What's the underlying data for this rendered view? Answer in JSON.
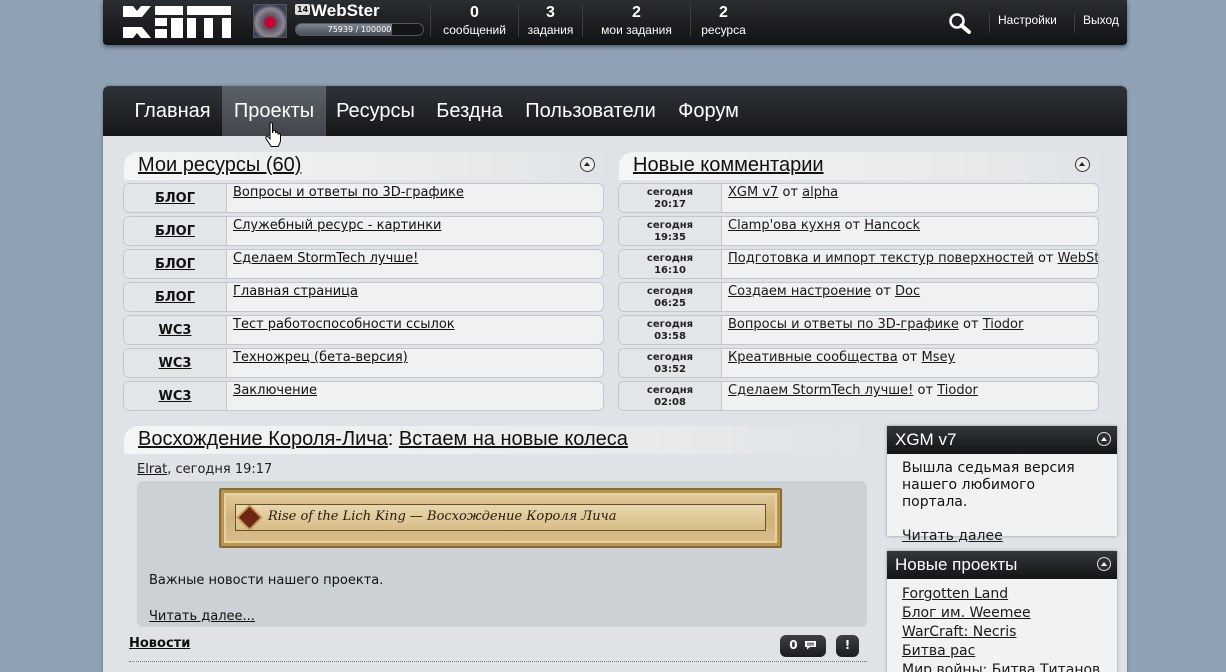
{
  "topbar": {
    "user": {
      "level": "14",
      "name": "WebSter",
      "xp": "75939 / 100000",
      "xp_fraction": 0.759
    },
    "stats": [
      {
        "value": "0",
        "label": "сообщений"
      },
      {
        "value": "3",
        "label": "задания"
      },
      {
        "value": "2",
        "label": "мои задания"
      },
      {
        "value": "2",
        "label": "ресурса"
      }
    ],
    "links": {
      "settings": "Настройки",
      "logout": "Выход"
    }
  },
  "nav": {
    "items": [
      "Главная",
      "Проекты",
      "Ресурсы",
      "Бездна",
      "Пользователи",
      "Форум"
    ],
    "active": "Проекты"
  },
  "my_resources": {
    "title": "Мои ресурсы (60)",
    "rows": [
      {
        "tag": "БЛОГ",
        "text": "Вопросы и ответы по 3D-графике"
      },
      {
        "tag": "БЛОГ",
        "text": "Служебный ресурс - картинки"
      },
      {
        "tag": "БЛОГ",
        "text": "Сделаем StormTech лучше!"
      },
      {
        "tag": "БЛОГ",
        "text": "Главная страница"
      },
      {
        "tag": "WC3",
        "text": "Тест работоспособности ссылок"
      },
      {
        "tag": "WC3",
        "text": "Техножрец (бета-версия)"
      },
      {
        "tag": "WC3",
        "text": "Заключение"
      }
    ]
  },
  "new_comments": {
    "title": "Новые комментарии",
    "by": "от",
    "rows": [
      {
        "day": "сегодня",
        "time": "20:17",
        "topic": "XGM v7",
        "author": "alpha"
      },
      {
        "day": "сегодня",
        "time": "19:35",
        "topic": "Clamp'ова кухня",
        "author": "Hancock"
      },
      {
        "day": "сегодня",
        "time": "16:10",
        "topic": "Подготовка и импорт текстур поверхностей",
        "author": "WebSter"
      },
      {
        "day": "сегодня",
        "time": "06:25",
        "topic": "Создаем настроение",
        "author": "Doc"
      },
      {
        "day": "сегодня",
        "time": "03:58",
        "topic": "Вопросы и ответы по 3D-графике",
        "author": "Tiodor"
      },
      {
        "day": "сегодня",
        "time": "03:52",
        "topic": "Креативные сообщества",
        "author": "Msey"
      },
      {
        "day": "сегодня",
        "time": "02:08",
        "topic": "Сделаем StormTech лучше!",
        "author": "Tiodor"
      }
    ]
  },
  "news": {
    "project": "Восхождение Короля-Лича",
    "separator": ":",
    "title": "Встаем на новые колеса",
    "author": "Elrat",
    "date": ", сегодня 19:17",
    "banner_text": "Rise of the Lich King — Восхождение Короля Лича",
    "summary": "Важные новости нашего проекта.",
    "read_more": "Читать далее...",
    "category": "Новости",
    "comments_count": "0",
    "report": "!"
  },
  "side_xgm": {
    "title": "XGM v7",
    "text": "Вышла седьмая версия нашего любимого портала.",
    "link": "Читать далее"
  },
  "side_projects": {
    "title": "Новые проекты",
    "items": [
      "Forgotten Land",
      "Блог им. Weemee",
      "WarCraft: Necris",
      "Битва рас",
      "Мир войны: Битва Титанов"
    ]
  },
  "colors": {
    "background": "#8fa1b4",
    "panel": "#dfe3e7",
    "bar": "#15171a"
  }
}
